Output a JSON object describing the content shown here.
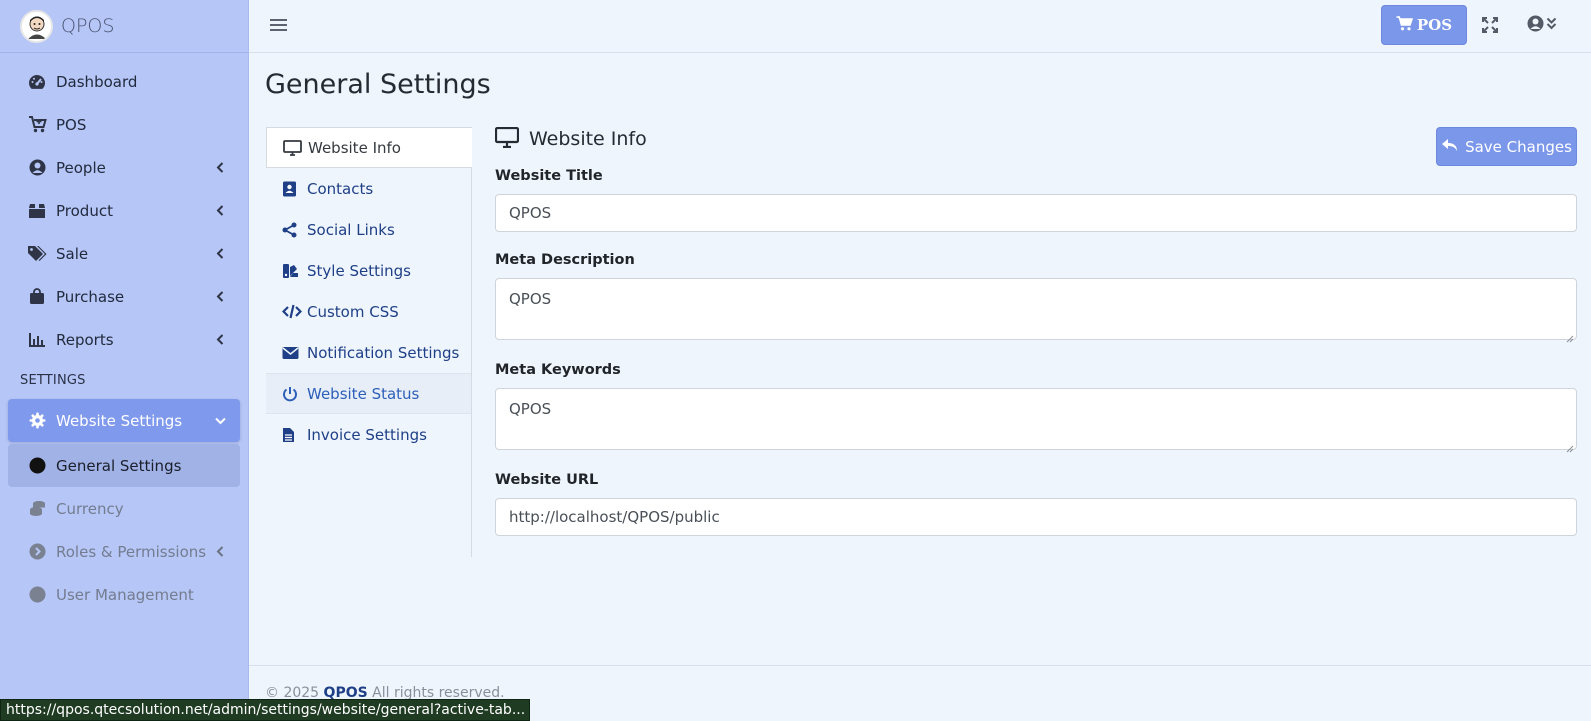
{
  "brand": {
    "name": "QPOS"
  },
  "sidebar": {
    "items": [
      {
        "label": "Dashboard",
        "icon": "gauge-icon"
      },
      {
        "label": "POS",
        "icon": "cart-plus-icon"
      },
      {
        "label": "People",
        "icon": "user-circle-icon"
      },
      {
        "label": "Product",
        "icon": "box-icon"
      },
      {
        "label": "Sale",
        "icon": "tags-icon"
      },
      {
        "label": "Purchase",
        "icon": "shopping-bag-icon"
      },
      {
        "label": "Reports",
        "icon": "bar-chart-icon"
      }
    ],
    "section_header": "SETTINGS",
    "settings_items": [
      {
        "label": "Website Settings",
        "icon": "gear-icon"
      },
      {
        "label": "General Settings",
        "icon": "circle-icon"
      },
      {
        "label": "Currency",
        "icon": "coins-icon"
      },
      {
        "label": "Roles & Permissions",
        "icon": "chevron-circle-icon"
      },
      {
        "label": "User Management",
        "icon": "circle-icon"
      }
    ]
  },
  "topbar": {
    "pos_label": "POS"
  },
  "page": {
    "title": "General Settings"
  },
  "tabs": [
    {
      "label": "Website Info",
      "icon": "desktop-icon"
    },
    {
      "label": "Contacts",
      "icon": "address-book-icon"
    },
    {
      "label": "Social Links",
      "icon": "share-icon"
    },
    {
      "label": "Style Settings",
      "icon": "swatchbook-icon"
    },
    {
      "label": "Custom CSS",
      "icon": "code-icon"
    },
    {
      "label": "Notification Settings",
      "icon": "envelope-icon"
    },
    {
      "label": "Website Status",
      "icon": "power-icon"
    },
    {
      "label": "Invoice Settings",
      "icon": "file-icon"
    }
  ],
  "panel": {
    "title": "Website Info",
    "save_label": "Save Changes",
    "fields": {
      "website_title": {
        "label": "Website Title",
        "value": "QPOS"
      },
      "meta_description": {
        "label": "Meta Description",
        "value": "QPOS"
      },
      "meta_keywords": {
        "label": "Meta Keywords",
        "value": "QPOS"
      },
      "website_url": {
        "label": "Website URL",
        "value": "http://localhost/QPOS/public"
      }
    }
  },
  "footer": {
    "prefix": "© 2025",
    "brand": "QPOS",
    "suffix": "All rights reserved."
  },
  "statusbar": {
    "url": "https://qpos.qtecsolution.net/admin/settings/website/general?active-tab..."
  },
  "colors": {
    "sidebar_bg": "#b5c6f7",
    "accent": "#7b97ea",
    "link": "#1f3f86",
    "page_bg": "#eef5fd"
  }
}
